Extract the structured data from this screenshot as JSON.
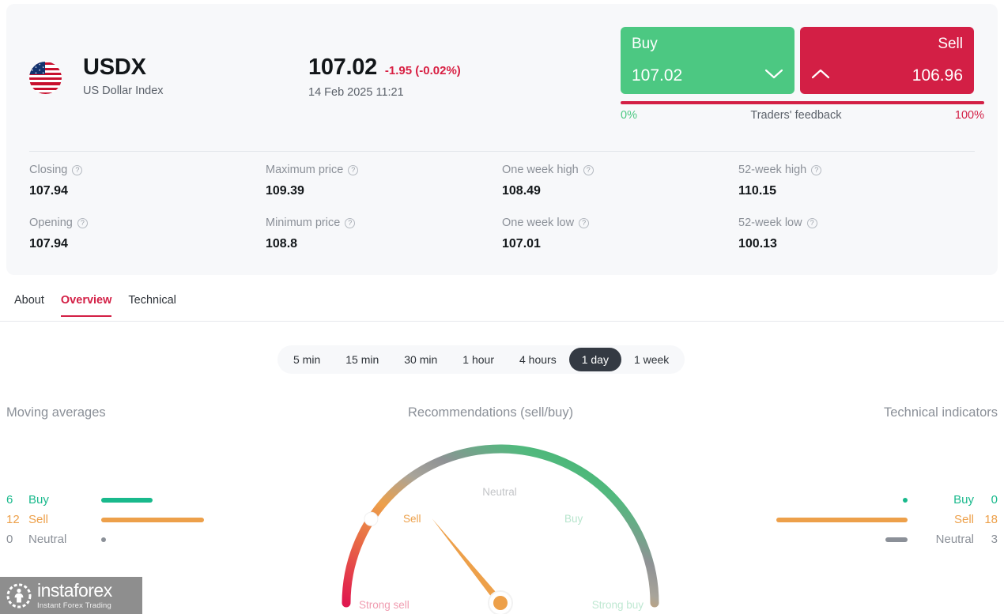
{
  "quote": {
    "flag_icon": "us-flag-icon",
    "symbol": "USDX",
    "description": "US Dollar Index",
    "price": "107.02",
    "change": "-1.95 (-0.02%)",
    "timestamp": "14 Feb 2025 11:21"
  },
  "trade": {
    "buy_label": "Buy",
    "buy_price": "107.02",
    "buy_icon": "chevron-down-icon",
    "sell_label": "Sell",
    "sell_price": "106.96",
    "sell_icon": "chevron-up-icon",
    "feedback_label": "Traders' feedback",
    "feedback_left": "0%",
    "feedback_right": "100%",
    "buy_color": "#4cc882",
    "sell_color": "#d31f45",
    "feedback_sell_percent": 100
  },
  "stats": [
    {
      "label": "Closing",
      "value": "107.94"
    },
    {
      "label": "Maximum price",
      "value": "109.39"
    },
    {
      "label": "One week high",
      "value": "108.49"
    },
    {
      "label": "52-week high",
      "value": "110.15"
    },
    {
      "label": "Opening",
      "value": "107.94"
    },
    {
      "label": "Minimum price",
      "value": "108.8"
    },
    {
      "label": "One week low",
      "value": "107.01"
    },
    {
      "label": "52-week low",
      "value": "100.13"
    }
  ],
  "tabs": [
    {
      "label": "About",
      "active": false
    },
    {
      "label": "Overview",
      "active": true
    },
    {
      "label": "Technical",
      "active": false
    }
  ],
  "timeframes": [
    {
      "label": "5 min",
      "active": false
    },
    {
      "label": "15 min",
      "active": false
    },
    {
      "label": "30 min",
      "active": false
    },
    {
      "label": "1 hour",
      "active": false
    },
    {
      "label": "4 hours",
      "active": false
    },
    {
      "label": "1 day",
      "active": true
    },
    {
      "label": "1 week",
      "active": false
    }
  ],
  "moving_averages": {
    "title": "Moving averages",
    "rows": [
      {
        "count": "6",
        "name": "Buy",
        "value": 6,
        "color": "#19b98c"
      },
      {
        "count": "12",
        "name": "Sell",
        "value": 12,
        "color": "#eda04a"
      },
      {
        "count": "0",
        "name": "Neutral",
        "value": 0,
        "color": "#8b9098"
      }
    ]
  },
  "technical_indicators": {
    "title": "Technical indicators",
    "rows": [
      {
        "count": "0",
        "name": "Buy",
        "value": 0,
        "color": "#19b98c"
      },
      {
        "count": "18",
        "name": "Sell",
        "value": 18,
        "color": "#eda04a"
      },
      {
        "count": "3",
        "name": "Neutral",
        "value": 3,
        "color": "#8b9098"
      }
    ]
  },
  "chart_data": {
    "type": "gauge",
    "title": "Recommendations (sell/buy)",
    "zones": [
      {
        "label": "Strong sell",
        "color": "#e0194f"
      },
      {
        "label": "Sell",
        "color": "#eda04a"
      },
      {
        "label": "Neutral",
        "color": "#9b9b9b"
      },
      {
        "label": "Buy",
        "color": "#43ba7f"
      },
      {
        "label": "Strong buy",
        "color": "#2fae63"
      }
    ],
    "needle_value": "Sell",
    "needle_angle_deg": 129,
    "marker_angle_deg": 147,
    "axis_range_deg": [
      0,
      180
    ]
  },
  "logo": {
    "name": "instaforex",
    "tagline": "Instant Forex Trading",
    "mark_icon": "instaforex-gear-icon"
  }
}
